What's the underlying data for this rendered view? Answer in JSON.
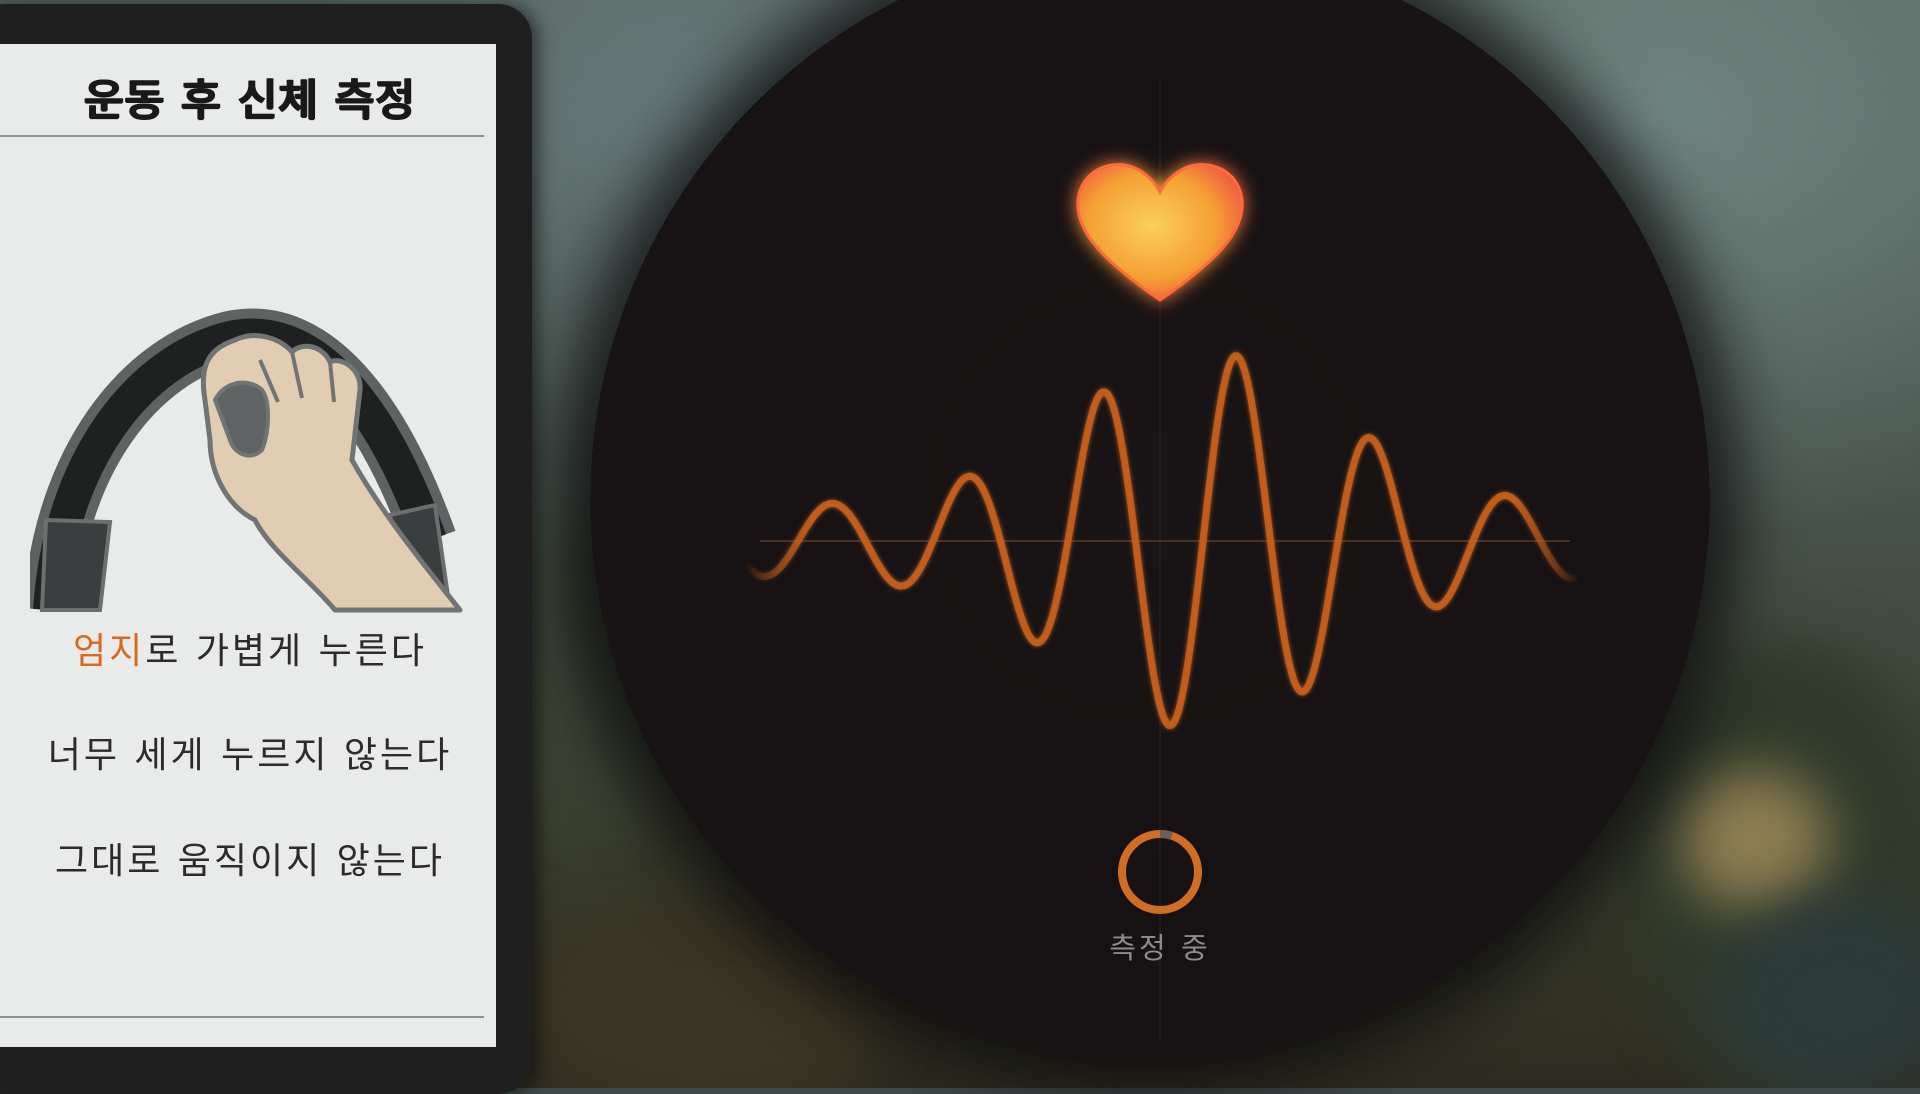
{
  "card": {
    "title": "운동 후 신체 측정",
    "instructions": [
      {
        "highlight": "엄지",
        "rest": "로 가볍게 누른다"
      },
      {
        "text": "너무 세게 누르지 않는다"
      },
      {
        "text": "그대로 움직이지 않는다"
      }
    ]
  },
  "measurement": {
    "status": "측정 중",
    "progress": 0.05
  },
  "colors": {
    "accent": "#d9691d",
    "waveform": "#c8611c",
    "heart_core": "#f7b23a",
    "heart_edge": "#ef3a47"
  },
  "icons": {
    "heart": "heart-icon",
    "spinner": "loading-ring-icon",
    "illustration": "thumb-press-ring-con-icon"
  }
}
